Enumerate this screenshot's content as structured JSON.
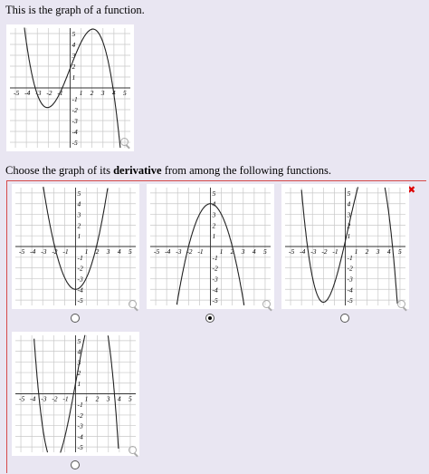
{
  "question": {
    "statement": "This is the graph of a function.",
    "choose_pre": "Choose the graph of its ",
    "choose_bold": "derivative",
    "choose_post": " from among the following functions."
  },
  "axis_ticks": {
    "x": [
      "-5",
      "-4",
      "-3",
      "-2",
      "-1",
      "1",
      "2",
      "3",
      "4",
      "5"
    ],
    "y": [
      "5",
      "4",
      "3",
      "2",
      "1",
      "-1",
      "-2",
      "-3",
      "-4",
      "-5"
    ]
  },
  "error_icon": "✖",
  "graphs": [
    {
      "id": "given",
      "type": "cubic",
      "curve": "-(x+3)(x+1)(x-4)/4 style: local max near (-2.5,4), falls through (0,0.5), min near (2.5,-7), rises past x=4"
    },
    {
      "id": "A",
      "type": "parabola",
      "vertex": [
        0,
        -4
      ],
      "roots": [
        -1.9,
        1.9
      ]
    },
    {
      "id": "B",
      "type": "parabola",
      "vertex": [
        0,
        4
      ],
      "roots": [
        -2,
        2
      ]
    },
    {
      "id": "C",
      "type": "cubic",
      "local_max": [
        -2,
        4.5
      ],
      "local_min": [
        2.5,
        -7
      ]
    },
    {
      "id": "D",
      "type": "cubic",
      "local_min": [
        -2,
        -4.5
      ],
      "local_max": [
        2,
        7
      ]
    }
  ],
  "selected_option": "B"
}
